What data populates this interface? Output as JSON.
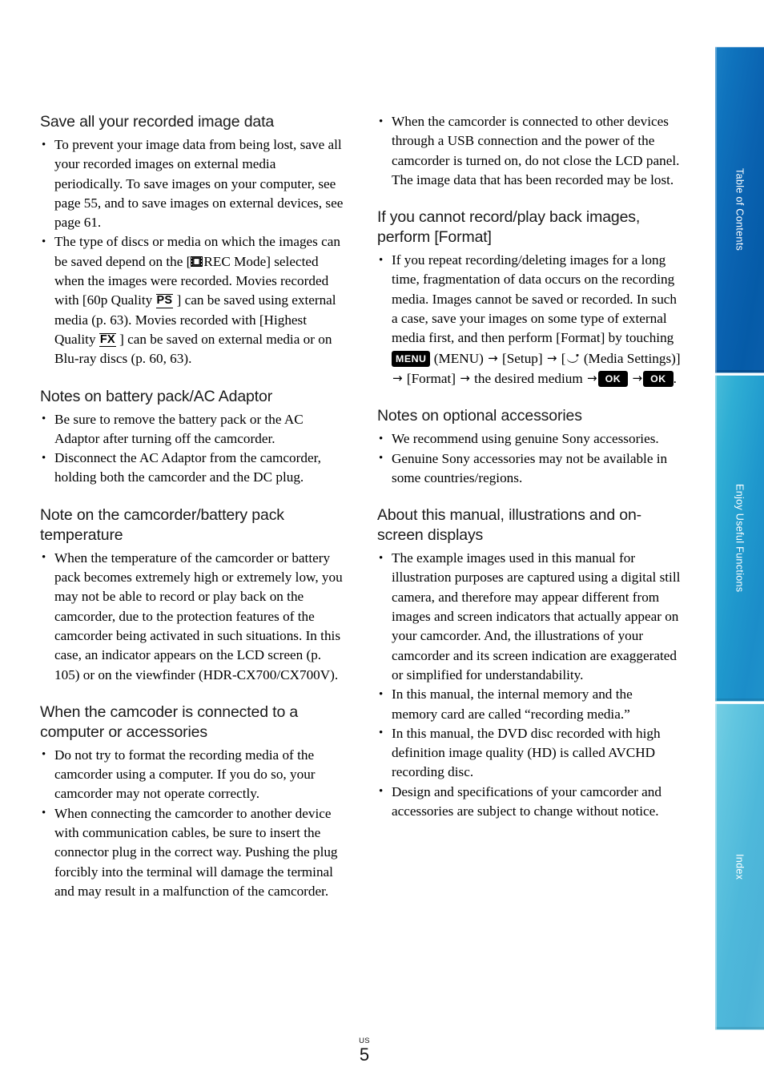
{
  "page": {
    "folio_region": "US",
    "folio_number": "5"
  },
  "sidebar": {
    "tabs": [
      {
        "label": "Table of Contents",
        "color": "#0a62b0"
      },
      {
        "label": "Enjoy Useful Functions",
        "color": "#1f98cd"
      },
      {
        "label": "Index",
        "color": "#4eb8da"
      }
    ]
  },
  "left_column": {
    "sections": [
      {
        "heading": "Save all your recorded image data",
        "bullets": [
          {
            "parts": [
              {
                "t": "text",
                "v": "To prevent your image data from being lost, save all your recorded images on external media periodically. To save images on your computer, see page 55, and to save images on external devices, see page 61."
              }
            ]
          },
          {
            "parts": [
              {
                "t": "text",
                "v": "The type of discs or media on which the images can be saved depend on the ["
              },
              {
                "t": "icon",
                "v": "film-strip-icon"
              },
              {
                "t": "text",
                "v": "REC Mode] selected when the images were recorded. Movies recorded with [60p Quality "
              },
              {
                "t": "ovline",
                "v": "PS"
              },
              {
                "t": "text",
                "v": " ] can be saved using external media (p. 63). Movies recorded with [Highest Quality "
              },
              {
                "t": "ovline",
                "v": "FX"
              },
              {
                "t": "text",
                "v": " ] can be saved on external media or on Blu-ray discs (p. 60, 63)."
              }
            ]
          }
        ]
      },
      {
        "heading": "Notes on battery pack/AC Adaptor",
        "bullets": [
          {
            "parts": [
              {
                "t": "text",
                "v": "Be sure to remove the battery pack or the AC Adaptor after turning off the camcorder."
              }
            ]
          },
          {
            "parts": [
              {
                "t": "text",
                "v": "Disconnect the AC Adaptor from the camcorder, holding both the camcorder and the DC plug."
              }
            ]
          }
        ]
      },
      {
        "heading": "Note on the camcorder/battery pack temperature",
        "bullets": [
          {
            "parts": [
              {
                "t": "text",
                "v": "When the temperature of the camcorder or battery pack becomes extremely high or extremely low, you may not be able to record or play back on the camcorder, due to the protection features of the camcorder being activated in such situations. In this case, an indicator appears on the LCD screen (p. 105) or on the viewfinder (HDR-CX700/CX700V)."
              }
            ]
          }
        ]
      },
      {
        "heading": "When the camcoder is connected to a computer or accessories",
        "bullets": [
          {
            "parts": [
              {
                "t": "text",
                "v": "Do not try to format the recording media of the camcorder using a computer. If you do so, your camcorder may not operate correctly."
              }
            ]
          },
          {
            "parts": [
              {
                "t": "text",
                "v": "When connecting the camcorder to another device with communication cables, be sure to insert the connector plug in the correct way. Pushing the plug forcibly into the terminal will damage the terminal and may result in a malfunction of the camcorder."
              }
            ]
          }
        ]
      }
    ]
  },
  "right_column": {
    "sections": [
      {
        "heading": "",
        "bullets": [
          {
            "parts": [
              {
                "t": "text",
                "v": "When the camcorder is connected to other devices through a USB connection and the power of the camcorder is turned on, do not close the LCD panel. The image data that has been recorded may be lost."
              }
            ]
          }
        ]
      },
      {
        "heading": "If you cannot record/play back images, perform [Format]",
        "bullets": [
          {
            "parts": [
              {
                "t": "text",
                "v": "If you repeat recording/deleting images for a long time, fragmentation of data occurs on the recording media. Images cannot be saved or recorded. In such a case, save your images on some type of external media first, and then perform [Format] by touching "
              },
              {
                "t": "badge",
                "v": "MENU"
              },
              {
                "t": "text",
                "v": " (MENU) "
              },
              {
                "t": "arrow",
                "v": "→"
              },
              {
                "t": "text",
                "v": " [Setup] "
              },
              {
                "t": "arrow",
                "v": "→"
              },
              {
                "t": "text",
                "v": " ["
              },
              {
                "t": "icon",
                "v": "media-settings-icon"
              },
              {
                "t": "text",
                "v": " (Media Settings)] "
              },
              {
                "t": "arrow",
                "v": "→"
              },
              {
                "t": "text",
                "v": " [Format] "
              },
              {
                "t": "arrow",
                "v": "→"
              },
              {
                "t": "text",
                "v": " the desired medium "
              },
              {
                "t": "arrow",
                "v": "→"
              },
              {
                "t": "badge-ok",
                "v": "OK"
              },
              {
                "t": "text",
                "v": " "
              },
              {
                "t": "arrow",
                "v": "→"
              },
              {
                "t": "badge-ok",
                "v": "OK"
              },
              {
                "t": "text",
                "v": "."
              }
            ]
          }
        ]
      },
      {
        "heading": "Notes on optional accessories",
        "bullets": [
          {
            "parts": [
              {
                "t": "text",
                "v": "We recommend using genuine Sony accessories."
              }
            ]
          },
          {
            "parts": [
              {
                "t": "text",
                "v": "Genuine Sony accessories may not be available in some countries/regions."
              }
            ]
          }
        ]
      },
      {
        "heading": "About this manual, illustrations and on-screen displays",
        "bullets": [
          {
            "parts": [
              {
                "t": "text",
                "v": "The example images used in this manual for illustration purposes are captured using a digital still camera, and therefore may appear different from images and screen indicators that actually appear on your camcorder. And, the illustrations of your camcorder and its screen indication are exaggerated or simplified for understandability."
              }
            ]
          },
          {
            "parts": [
              {
                "t": "text",
                "v": "In this manual, the internal memory and the memory card are called “recording media.”"
              }
            ]
          },
          {
            "parts": [
              {
                "t": "text",
                "v": "In this manual, the DVD disc recorded with high definition image quality (HD) is called AVCHD recording disc."
              }
            ]
          },
          {
            "parts": [
              {
                "t": "text",
                "v": "Design and specifications of your camcorder and accessories are subject to change without notice."
              }
            ]
          }
        ]
      }
    ]
  }
}
